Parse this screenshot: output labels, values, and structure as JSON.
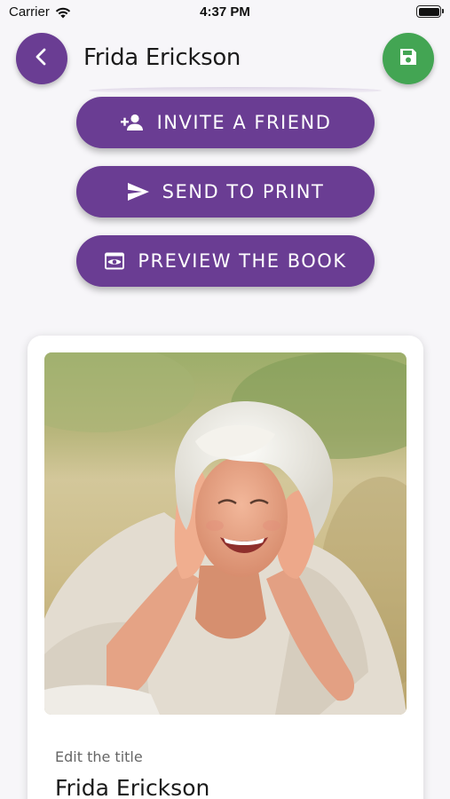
{
  "status_bar": {
    "carrier": "Carrier",
    "time": "4:37 PM",
    "icons": [
      "wifi-icon",
      "battery-icon"
    ]
  },
  "header": {
    "title": "Frida Erickson",
    "back_icon": "chevron-left-icon",
    "save_icon": "floppy-disk-icon"
  },
  "actions": {
    "invite": {
      "label": "INVITE A FRIEND",
      "icon": "person-add-icon"
    },
    "print": {
      "label": "SEND TO PRINT",
      "icon": "send-icon"
    },
    "preview": {
      "label": "PREVIEW THE BOOK",
      "icon": "eye-preview-icon"
    }
  },
  "card": {
    "photo": "smiling-elderly-woman-photo",
    "edit_label": "Edit the title",
    "title_value": "Frida Erickson"
  },
  "colors": {
    "primary": "#6a3d93",
    "save": "#43a553",
    "background": "#f7f6f9"
  }
}
